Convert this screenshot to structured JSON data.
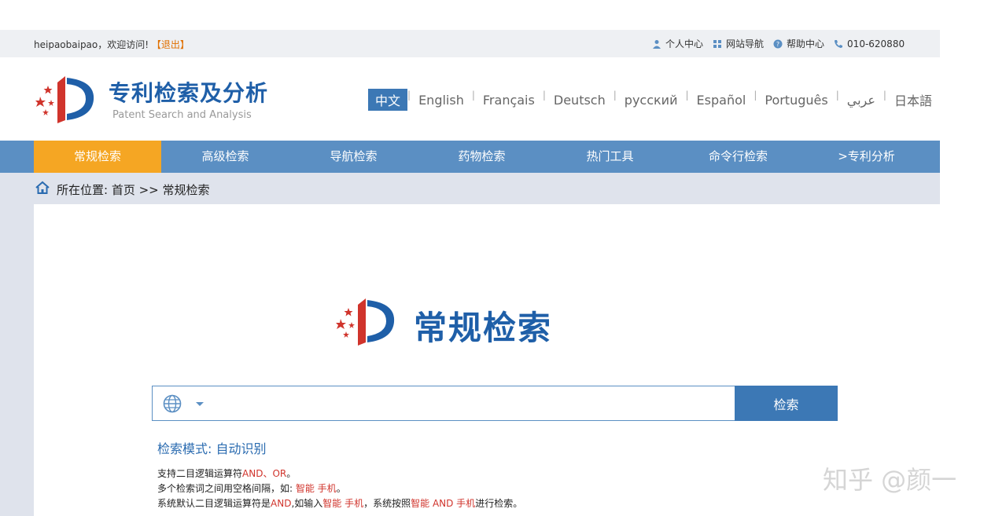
{
  "topbar": {
    "greeting": "heipaobaipao，欢迎访问!",
    "logout": "【退出】",
    "links": [
      "个人中心",
      "网站导航",
      "帮助中心",
      "010-620880"
    ]
  },
  "header": {
    "title": "专利检索及分析",
    "subtitle": "Patent Search and Analysis",
    "languages": [
      "中文",
      "English",
      "Français",
      "Deutsch",
      "русский",
      "Español",
      "Português",
      "عربي",
      "日本語"
    ]
  },
  "nav": {
    "items": [
      "常规检索",
      "高级检索",
      "导航检索",
      "药物检索",
      "热门工具",
      "命令行检索",
      ">专利分析"
    ]
  },
  "breadcrumb": {
    "text": "所在位置: 首页 >> 常规检索"
  },
  "hero": {
    "title": "常规检索"
  },
  "search": {
    "placeholder": "",
    "button": "检索"
  },
  "mode": {
    "label": "检索模式:",
    "value": "自动识别"
  },
  "tips": {
    "line1_pre": "支持二目逻辑运算符",
    "line1_red": "AND、OR",
    "line1_post": "。",
    "line2_pre": "多个检索词之间用空格间隔，如: ",
    "line2_red": "智能 手机",
    "line2_post": "。",
    "line3_a": "系统默认二目逻辑运算符是",
    "line3_b": "AND",
    "line3_c": ",如输入",
    "line3_d": "智能 手机",
    "line3_e": "，系统按照",
    "line3_f": "智能 AND 手机",
    "line3_g": "进行检索。"
  },
  "watermark": "知乎 @颜一",
  "colors": {
    "brand": "#1f5fa8",
    "nav": "#5b8fc3",
    "nav_active": "#f5a623",
    "button": "#3c78b5",
    "tip_red": "#d0342c"
  }
}
